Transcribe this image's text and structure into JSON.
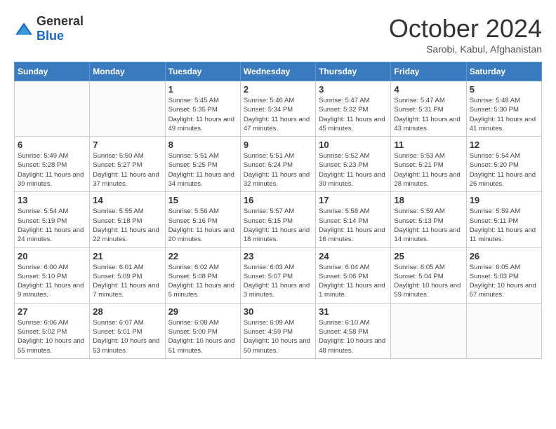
{
  "logo": {
    "general": "General",
    "blue": "Blue"
  },
  "title": {
    "month": "October 2024",
    "location": "Sarobi, Kabul, Afghanistan"
  },
  "weekdays": [
    "Sunday",
    "Monday",
    "Tuesday",
    "Wednesday",
    "Thursday",
    "Friday",
    "Saturday"
  ],
  "weeks": [
    [
      {
        "day": "",
        "sunrise": "",
        "sunset": "",
        "daylight": ""
      },
      {
        "day": "",
        "sunrise": "",
        "sunset": "",
        "daylight": ""
      },
      {
        "day": "1",
        "sunrise": "Sunrise: 5:45 AM",
        "sunset": "Sunset: 5:35 PM",
        "daylight": "Daylight: 11 hours and 49 minutes."
      },
      {
        "day": "2",
        "sunrise": "Sunrise: 5:46 AM",
        "sunset": "Sunset: 5:34 PM",
        "daylight": "Daylight: 11 hours and 47 minutes."
      },
      {
        "day": "3",
        "sunrise": "Sunrise: 5:47 AM",
        "sunset": "Sunset: 5:32 PM",
        "daylight": "Daylight: 11 hours and 45 minutes."
      },
      {
        "day": "4",
        "sunrise": "Sunrise: 5:47 AM",
        "sunset": "Sunset: 5:31 PM",
        "daylight": "Daylight: 11 hours and 43 minutes."
      },
      {
        "day": "5",
        "sunrise": "Sunrise: 5:48 AM",
        "sunset": "Sunset: 5:30 PM",
        "daylight": "Daylight: 11 hours and 41 minutes."
      }
    ],
    [
      {
        "day": "6",
        "sunrise": "Sunrise: 5:49 AM",
        "sunset": "Sunset: 5:28 PM",
        "daylight": "Daylight: 11 hours and 39 minutes."
      },
      {
        "day": "7",
        "sunrise": "Sunrise: 5:50 AM",
        "sunset": "Sunset: 5:27 PM",
        "daylight": "Daylight: 11 hours and 37 minutes."
      },
      {
        "day": "8",
        "sunrise": "Sunrise: 5:51 AM",
        "sunset": "Sunset: 5:25 PM",
        "daylight": "Daylight: 11 hours and 34 minutes."
      },
      {
        "day": "9",
        "sunrise": "Sunrise: 5:51 AM",
        "sunset": "Sunset: 5:24 PM",
        "daylight": "Daylight: 11 hours and 32 minutes."
      },
      {
        "day": "10",
        "sunrise": "Sunrise: 5:52 AM",
        "sunset": "Sunset: 5:23 PM",
        "daylight": "Daylight: 11 hours and 30 minutes."
      },
      {
        "day": "11",
        "sunrise": "Sunrise: 5:53 AM",
        "sunset": "Sunset: 5:21 PM",
        "daylight": "Daylight: 11 hours and 28 minutes."
      },
      {
        "day": "12",
        "sunrise": "Sunrise: 5:54 AM",
        "sunset": "Sunset: 5:20 PM",
        "daylight": "Daylight: 11 hours and 26 minutes."
      }
    ],
    [
      {
        "day": "13",
        "sunrise": "Sunrise: 5:54 AM",
        "sunset": "Sunset: 5:19 PM",
        "daylight": "Daylight: 11 hours and 24 minutes."
      },
      {
        "day": "14",
        "sunrise": "Sunrise: 5:55 AM",
        "sunset": "Sunset: 5:18 PM",
        "daylight": "Daylight: 11 hours and 22 minutes."
      },
      {
        "day": "15",
        "sunrise": "Sunrise: 5:56 AM",
        "sunset": "Sunset: 5:16 PM",
        "daylight": "Daylight: 11 hours and 20 minutes."
      },
      {
        "day": "16",
        "sunrise": "Sunrise: 5:57 AM",
        "sunset": "Sunset: 5:15 PM",
        "daylight": "Daylight: 11 hours and 18 minutes."
      },
      {
        "day": "17",
        "sunrise": "Sunrise: 5:58 AM",
        "sunset": "Sunset: 5:14 PM",
        "daylight": "Daylight: 11 hours and 16 minutes."
      },
      {
        "day": "18",
        "sunrise": "Sunrise: 5:59 AM",
        "sunset": "Sunset: 5:13 PM",
        "daylight": "Daylight: 11 hours and 14 minutes."
      },
      {
        "day": "19",
        "sunrise": "Sunrise: 5:59 AM",
        "sunset": "Sunset: 5:11 PM",
        "daylight": "Daylight: 11 hours and 11 minutes."
      }
    ],
    [
      {
        "day": "20",
        "sunrise": "Sunrise: 6:00 AM",
        "sunset": "Sunset: 5:10 PM",
        "daylight": "Daylight: 11 hours and 9 minutes."
      },
      {
        "day": "21",
        "sunrise": "Sunrise: 6:01 AM",
        "sunset": "Sunset: 5:09 PM",
        "daylight": "Daylight: 11 hours and 7 minutes."
      },
      {
        "day": "22",
        "sunrise": "Sunrise: 6:02 AM",
        "sunset": "Sunset: 5:08 PM",
        "daylight": "Daylight: 11 hours and 5 minutes."
      },
      {
        "day": "23",
        "sunrise": "Sunrise: 6:03 AM",
        "sunset": "Sunset: 5:07 PM",
        "daylight": "Daylight: 11 hours and 3 minutes."
      },
      {
        "day": "24",
        "sunrise": "Sunrise: 6:04 AM",
        "sunset": "Sunset: 5:06 PM",
        "daylight": "Daylight: 11 hours and 1 minute."
      },
      {
        "day": "25",
        "sunrise": "Sunrise: 6:05 AM",
        "sunset": "Sunset: 5:04 PM",
        "daylight": "Daylight: 10 hours and 59 minutes."
      },
      {
        "day": "26",
        "sunrise": "Sunrise: 6:05 AM",
        "sunset": "Sunset: 5:03 PM",
        "daylight": "Daylight: 10 hours and 57 minutes."
      }
    ],
    [
      {
        "day": "27",
        "sunrise": "Sunrise: 6:06 AM",
        "sunset": "Sunset: 5:02 PM",
        "daylight": "Daylight: 10 hours and 55 minutes."
      },
      {
        "day": "28",
        "sunrise": "Sunrise: 6:07 AM",
        "sunset": "Sunset: 5:01 PM",
        "daylight": "Daylight: 10 hours and 53 minutes."
      },
      {
        "day": "29",
        "sunrise": "Sunrise: 6:08 AM",
        "sunset": "Sunset: 5:00 PM",
        "daylight": "Daylight: 10 hours and 51 minutes."
      },
      {
        "day": "30",
        "sunrise": "Sunrise: 6:09 AM",
        "sunset": "Sunset: 4:59 PM",
        "daylight": "Daylight: 10 hours and 50 minutes."
      },
      {
        "day": "31",
        "sunrise": "Sunrise: 6:10 AM",
        "sunset": "Sunset: 4:58 PM",
        "daylight": "Daylight: 10 hours and 48 minutes."
      },
      {
        "day": "",
        "sunrise": "",
        "sunset": "",
        "daylight": ""
      },
      {
        "day": "",
        "sunrise": "",
        "sunset": "",
        "daylight": ""
      }
    ]
  ]
}
